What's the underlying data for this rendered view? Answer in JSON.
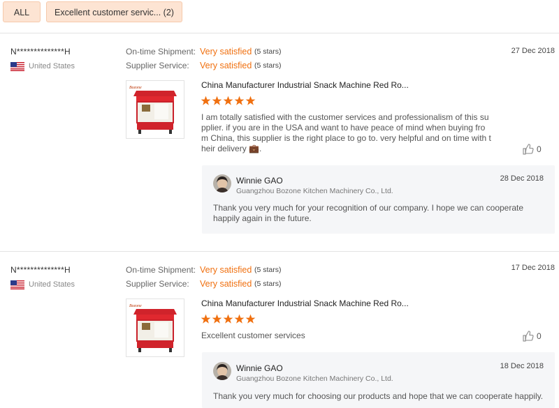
{
  "filters": {
    "all_label": "ALL",
    "excellent_label": "Excellent customer servic... (2)"
  },
  "labels": {
    "on_time_shipment": "On-time Shipment:",
    "supplier_service": "Supplier Service:"
  },
  "colors": {
    "accent": "#f07010",
    "chip_bg": "#fde4d3",
    "reply_bg": "#f5f6f8"
  },
  "reviews": [
    {
      "buyer": "N**************H",
      "country": "United States",
      "flag_icon": "us-flag-icon",
      "date": "27 Dec 2018",
      "shipment_rating": "Very satisfied",
      "shipment_stars": "(5 stars)",
      "service_rating": "Very satisfied",
      "service_stars": "(5 stars)",
      "product_title": "China Manufacturer Industrial Snack Machine Red Ro...",
      "stars": 5,
      "text": "I am totally satisfied with the customer services and professionalism of this supplier.  if you are in the USA and want to have peace of mind when buying from China, this supplier is the right place to go to.  very helpful and on time with their delivery 💼.",
      "likes": "0",
      "reply": {
        "name": "Winnie GAO",
        "company": "Guangzhou Bozone Kitchen Machinery Co., Ltd.",
        "date": "28 Dec 2018",
        "text": "Thank you very much for your recognition of our company. I hope we can cooperate happily again in the future."
      }
    },
    {
      "buyer": "N**************H",
      "country": "United States",
      "flag_icon": "us-flag-icon",
      "date": "17 Dec 2018",
      "shipment_rating": "Very satisfied",
      "shipment_stars": "(5 stars)",
      "service_rating": "Very satisfied",
      "service_stars": "(5 stars)",
      "product_title": "China Manufacturer Industrial Snack Machine Red Ro...",
      "stars": 5,
      "text": "Excellent customer services",
      "likes": "0",
      "reply": {
        "name": "Winnie GAO",
        "company": "Guangzhou Bozone Kitchen Machinery Co., Ltd.",
        "date": "18 Dec 2018",
        "text": "Thank you very much for choosing our products and hope that we can cooperate happily."
      }
    }
  ]
}
